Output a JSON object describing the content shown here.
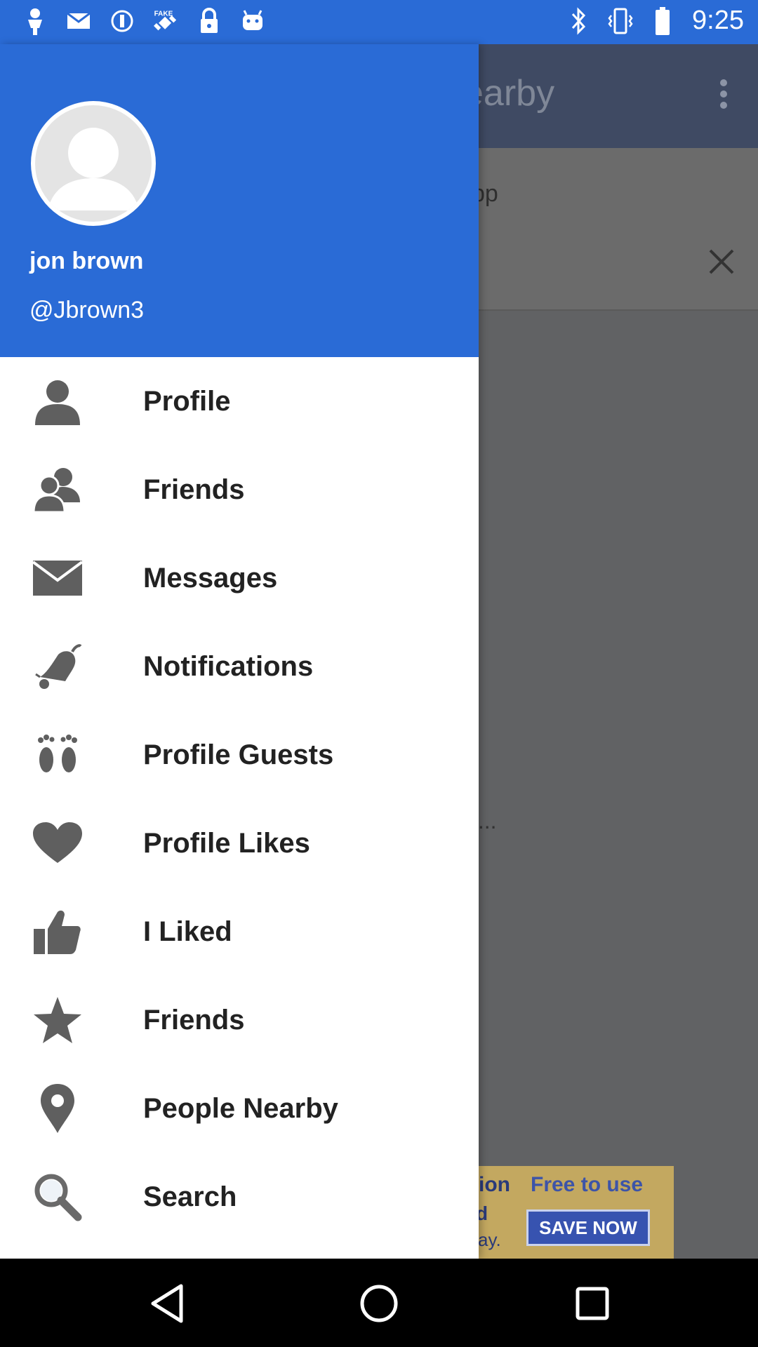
{
  "status_bar": {
    "time": "9:25",
    "icons": [
      "person-pin-icon",
      "mail-icon",
      "info-icon",
      "fake-gps-satellite-icon",
      "lock-icon",
      "android-icon",
      "bluetooth-icon",
      "vibrate-icon",
      "battery-icon"
    ]
  },
  "background_app": {
    "title_fragment": "earby",
    "banner_fragment": "pp",
    "content_fragment": "t...",
    "ad": {
      "line1a": "tion",
      "line1b": "Free to use",
      "line2": "d",
      "line3": "vay.",
      "button": "SAVE NOW"
    }
  },
  "drawer": {
    "user_name": "jon brown",
    "user_handle": "@Jbrown3",
    "menu": [
      {
        "label": "Profile",
        "icon": "person-icon"
      },
      {
        "label": "Friends",
        "icon": "friends-icon"
      },
      {
        "label": "Messages",
        "icon": "envelope-icon"
      },
      {
        "label": "Notifications",
        "icon": "bell-icon"
      },
      {
        "label": "Profile Guests",
        "icon": "footprints-icon"
      },
      {
        "label": "Profile Likes",
        "icon": "heart-icon"
      },
      {
        "label": "I Liked",
        "icon": "thumbs-up-icon"
      },
      {
        "label": "Friends",
        "icon": "star-icon"
      },
      {
        "label": "People Nearby",
        "icon": "location-pin-icon"
      },
      {
        "label": "Search",
        "icon": "search-icon"
      }
    ]
  },
  "colors": {
    "header_blue": "#2a6bd6",
    "icon_grey": "#5f5f5f",
    "scrim": "#616264"
  }
}
